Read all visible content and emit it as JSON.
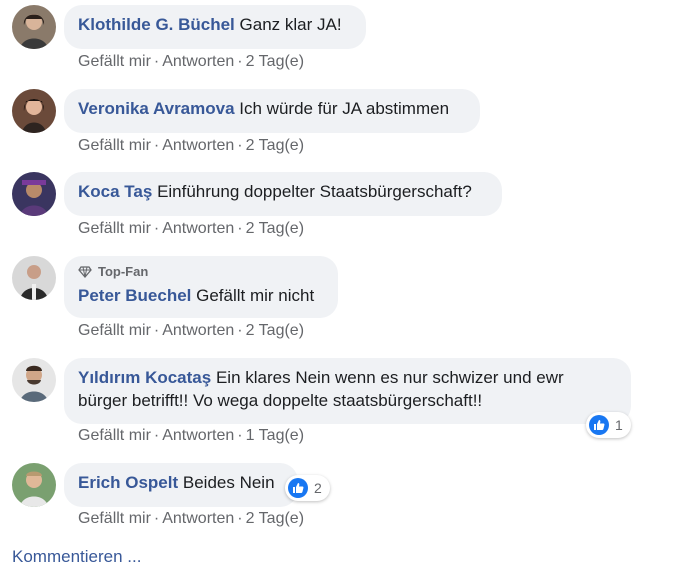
{
  "comments": [
    {
      "author": "Klothilde G. Büchel",
      "text": "Ganz klar JA!",
      "like": "Gefällt mir",
      "reply": "Antworten",
      "time": "2 Tag(e)"
    },
    {
      "author": "Veronika Avramova",
      "text": "Ich würde für JA abstimmen",
      "like": "Gefällt mir",
      "reply": "Antworten",
      "time": "2 Tag(e)"
    },
    {
      "author": "Koca Taş",
      "text": "Einführung doppelter Staatsbürgerschaft?",
      "like": "Gefällt mir",
      "reply": "Antworten",
      "time": "2 Tag(e)"
    },
    {
      "badge": "Top-Fan",
      "author": "Peter Buechel",
      "text": "Gefällt mir nicht",
      "like": "Gefällt mir",
      "reply": "Antworten",
      "time": "2 Tag(e)"
    },
    {
      "author": "Yıldırım Kocataş",
      "text": "Ein klares Nein wenn es nur schwizer und ewr bürger betrifft!! Vo wega doppelte staatsbürgerschaft!!",
      "like": "Gefällt mir",
      "reply": "Antworten",
      "time": "1 Tag(e)",
      "reactions": "1"
    },
    {
      "author": "Erich Ospelt",
      "text": "Beides Nein",
      "like": "Gefällt mir",
      "reply": "Antworten",
      "time": "2 Tag(e)",
      "reactions": "2"
    }
  ],
  "separator": "·",
  "more_link": "Kommentieren ...",
  "colors": {
    "author": "#385898",
    "bubble": "#f0f2f5",
    "meta": "#65676b",
    "like": "#1877f2"
  },
  "icons": {
    "reaction": "thumbs-up-icon",
    "top_fan": "diamond-icon"
  }
}
